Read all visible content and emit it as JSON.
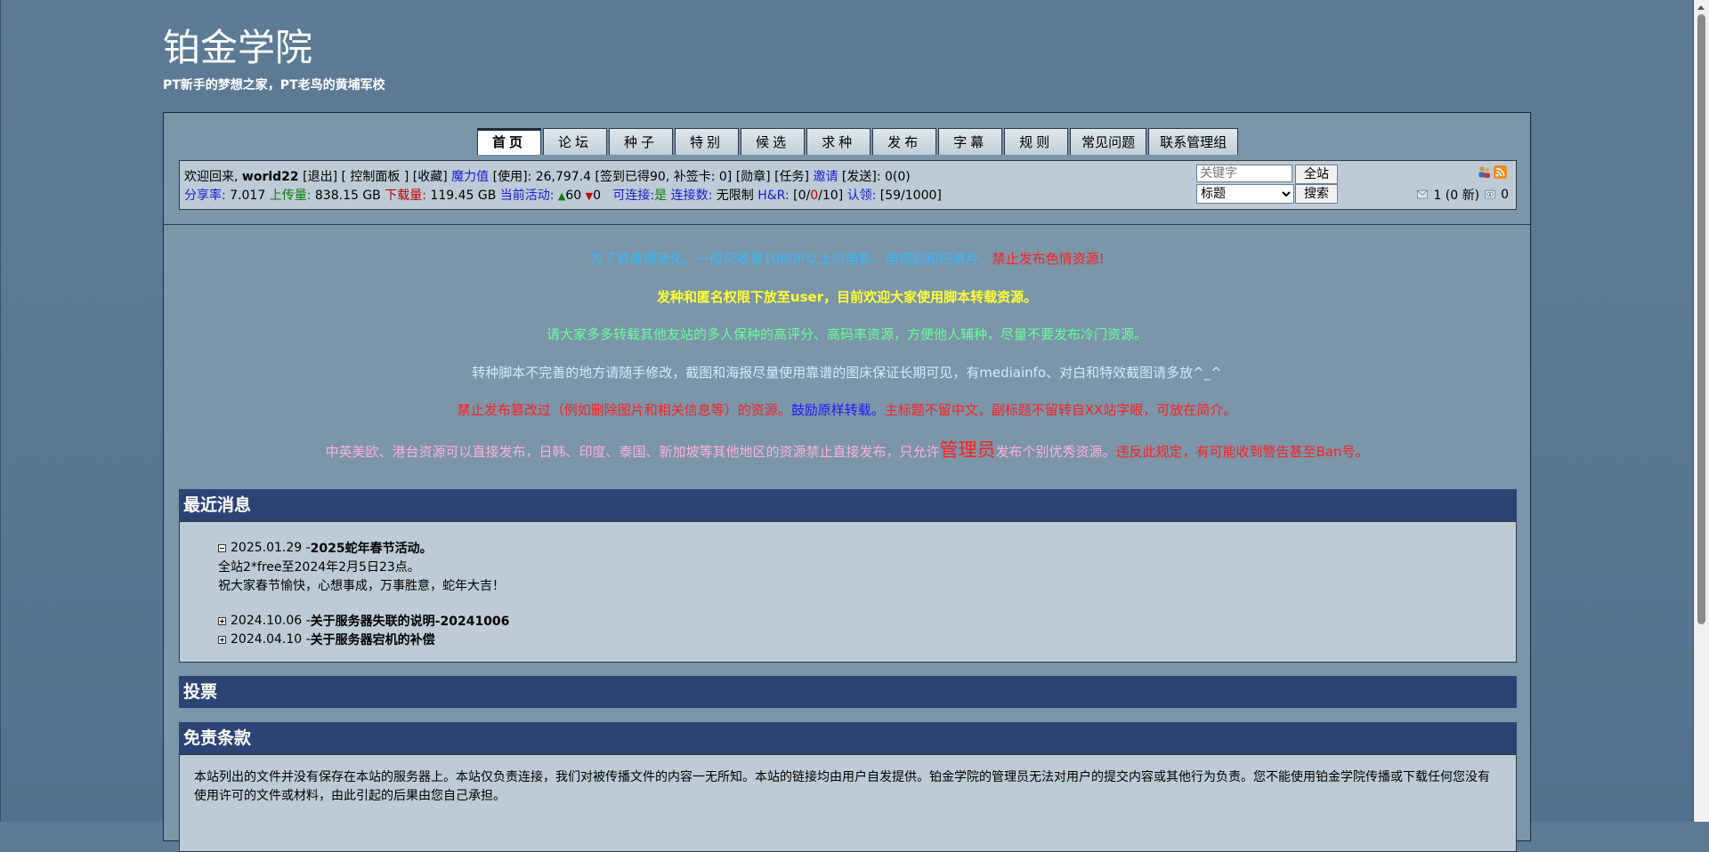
{
  "site": {
    "title": "铂金学院",
    "slogan": "PT新手的梦想之家，PT老鸟的黄埔军校"
  },
  "nav": [
    "首页",
    "论坛",
    "种子",
    "特别",
    "候选",
    "求种",
    "发布",
    "字幕",
    "规则",
    "常见问题",
    "联系管理组"
  ],
  "userbar": {
    "welcome": "欢迎回来, ",
    "username": "world22",
    "logout": "退出",
    "control_panel": "控制面板",
    "favorites": "收藏",
    "bonus_label": "魔力值",
    "bonus_use": "[使用]: 26,797.4",
    "signin": "[签到已得90, 补签卡: 0]",
    "medal": "[勋章]",
    "task": "[任务]",
    "invite": "邀请",
    "send": "[发送]: 0(0)",
    "ratio_label": "分享率:",
    "ratio": "7.017",
    "upload_label": "上传量:",
    "upload": "838.15 GB",
    "download_label": "下载量:",
    "download": "119.45 GB",
    "active_label": "当前活动:",
    "seeding": "60",
    "leeching": "0",
    "connectable_label": "可连接:",
    "connectable": "是",
    "connections_label": "连接数:",
    "connections": "无限制",
    "hr_label": "H&R:",
    "hr_open": "[0/",
    "hr_mid": "0",
    "hr_close": "/10]",
    "claim_label": "认领:",
    "claim": "[59/1000]",
    "messages": "1 (0 新)",
    "views": "0"
  },
  "search": {
    "placeholder": "关键字",
    "scope": "标题",
    "btn_all": "全站",
    "btn_search": "搜索"
  },
  "announcements": {
    "a1_main": "为了资源规范化，一般只收录1080P以上的电影、电视剧和纪录片。",
    "a1_warn": "禁止发布色情资源!",
    "a2": "发种和匿名权限下放至user，目前欢迎大家使用脚本转载资源。",
    "a3": "请大家多多转载其他友站的多人保种的高评分、高码率资源，方便他人辅种，尽量不要发布冷门资源。",
    "a4": "转种脚本不完善的地方请随手修改，截图和海报尽量使用靠谱的图床保证长期可见，有mediainfo、对白和特效截图请多放^_^",
    "a5_pre": "禁止发布篡改过（例如删除图片和相关信息等）的资源。",
    "a5_link": "鼓励原样转载。",
    "a5_post": "主标题不留中文，副标题不留转自XX站字眼，可放在简介。",
    "a6_pre": "中英美欧、港台资源可以直接发布，日韩、印度、泰国、新加坡等其他地区的资源禁止直接发布，只允许",
    "a6_big": "管理员",
    "a6_mid": "发布个别优秀资源。",
    "a6_warn": "违反此规定，有可能收到警告甚至Ban号。"
  },
  "news": {
    "heading": "最近消息",
    "items": [
      {
        "date": "2025.01.29 - ",
        "title": "2025蛇年春节活动。",
        "body": [
          "全站2*free至2024年2月5日23点。",
          "祝大家春节愉快，心想事成，万事胜意，蛇年大吉！"
        ]
      },
      {
        "date": "2024.10.06 - ",
        "title": "关于服务器失联的说明-20241006"
      },
      {
        "date": "2024.04.10 - ",
        "title": "关于服务器宕机的补偿"
      }
    ]
  },
  "poll": {
    "heading": "投票"
  },
  "disclaimer": {
    "heading": "免责条款",
    "text": "本站列出的文件并没有保存在本站的服务器上。本站仅负责连接，我们对被传播文件的内容一无所知。本站的链接均由用户自发提供。铂金学院的管理员无法对用户的提交内容或其他行为负责。您不能使用铂金学院传播或下载任何您没有使用许可的文件或材料，由此引起的后果由您自己承担。"
  },
  "colors": {
    "page_bg": "#577791",
    "panel_bg": "#7b95a9",
    "bar_bg": "#bccbd6",
    "section_head": "#2c4474"
  }
}
